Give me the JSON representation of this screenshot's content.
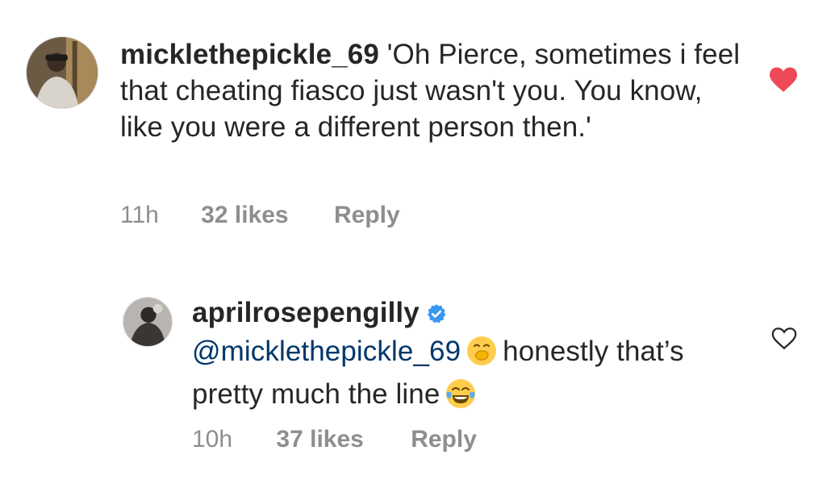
{
  "comments": [
    {
      "username": "micklethepickle_69",
      "text": "'Oh Pierce, sometimes i feel that cheating fiasco just wasn't you. You know, like you were a different person then.'",
      "time": "11h",
      "likes": "32 likes",
      "reply_label": "Reply",
      "liked": true,
      "avatar_icon": "profile-photo"
    },
    {
      "username": "aprilrosepengilly",
      "verified": true,
      "mention": "@micklethepickle_69",
      "emoji_1": "face-with-hand-over-mouth",
      "text": "honestly that’s pretty much the line",
      "emoji_2": "face-with-tears-of-joy",
      "time": "10h",
      "likes": "37 likes",
      "reply_label": "Reply",
      "liked": false,
      "avatar_icon": "profile-photo"
    }
  ],
  "colors": {
    "heart_filled": "#ed4956",
    "meta_gray": "#8e8e8e",
    "verified_blue": "#3897f0",
    "text": "#262626"
  }
}
